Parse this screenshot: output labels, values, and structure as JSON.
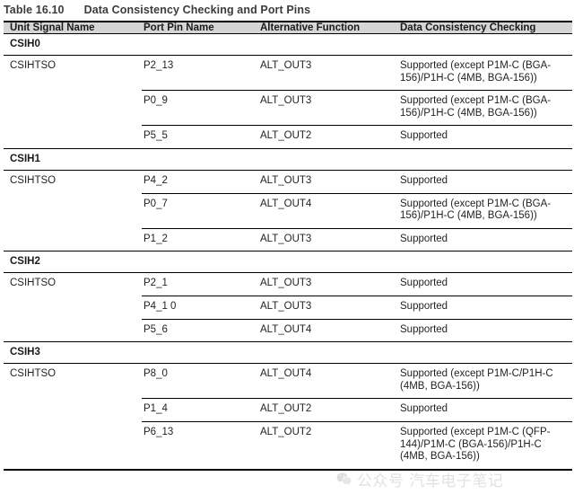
{
  "title": {
    "number": "Table 16.10",
    "caption": "Data Consistency Checking and Port Pins"
  },
  "table": {
    "columns": [
      "Unit Signal Name",
      "Port Pin Name",
      "Alternative Function",
      "Data Consistency Checking"
    ],
    "groups": [
      {
        "name": "CSIH0",
        "rows": [
          {
            "unit": "CSIHTSO",
            "pin": "P2_13",
            "alt": "ALT_OUT3",
            "dcc": "Supported (except P1M-C (BGA-156)/P1H-C (4MB, BGA-156))"
          },
          {
            "unit": "",
            "pin": "P0_9",
            "alt": "ALT_OUT3",
            "dcc": "Supported (except P1M-C (BGA-156)/P1H-C (4MB, BGA-156))"
          },
          {
            "unit": "",
            "pin": "P5_5",
            "alt": "ALT_OUT2",
            "dcc": "Supported"
          }
        ]
      },
      {
        "name": "CSIH1",
        "rows": [
          {
            "unit": "CSIHTSO",
            "pin": "P4_2",
            "alt": "ALT_OUT3",
            "dcc": "Supported"
          },
          {
            "unit": "",
            "pin": "P0_7",
            "alt": "ALT_OUT4",
            "dcc": "Supported (except P1M-C (BGA-156)/P1H-C (4MB, BGA-156))"
          },
          {
            "unit": "",
            "pin": "P1_2",
            "alt": "ALT_OUT3",
            "dcc": "Supported"
          }
        ]
      },
      {
        "name": "CSIH2",
        "rows": [
          {
            "unit": "CSIHTSO",
            "pin": "P2_1",
            "alt": "ALT_OUT3",
            "dcc": "Supported"
          },
          {
            "unit": "",
            "pin": "P4_1 0",
            "alt": "ALT_OUT3",
            "dcc": "Supported"
          },
          {
            "unit": "",
            "pin": "P5_6",
            "alt": "ALT_OUT4",
            "dcc": "Supported"
          }
        ]
      },
      {
        "name": "CSIH3",
        "rows": [
          {
            "unit": "CSIHTSO",
            "pin": "P8_0",
            "alt": "ALT_OUT4",
            "dcc": "Supported (except P1M-C/P1H-C (4MB, BGA-156))"
          },
          {
            "unit": "",
            "pin": "P1_4",
            "alt": "ALT_OUT2",
            "dcc": "Supported"
          },
          {
            "unit": "",
            "pin": "P6_13",
            "alt": "ALT_OUT2",
            "dcc": "Supported (except P1M-C (QFP-144)/P1M-C (BGA-156)/P1H-C (4MB, BGA-156))"
          }
        ]
      }
    ]
  },
  "watermark": {
    "text": "公众号 汽车电子笔记",
    "logo_icon": "wechat-icon",
    "color": "#b9b9b9"
  }
}
